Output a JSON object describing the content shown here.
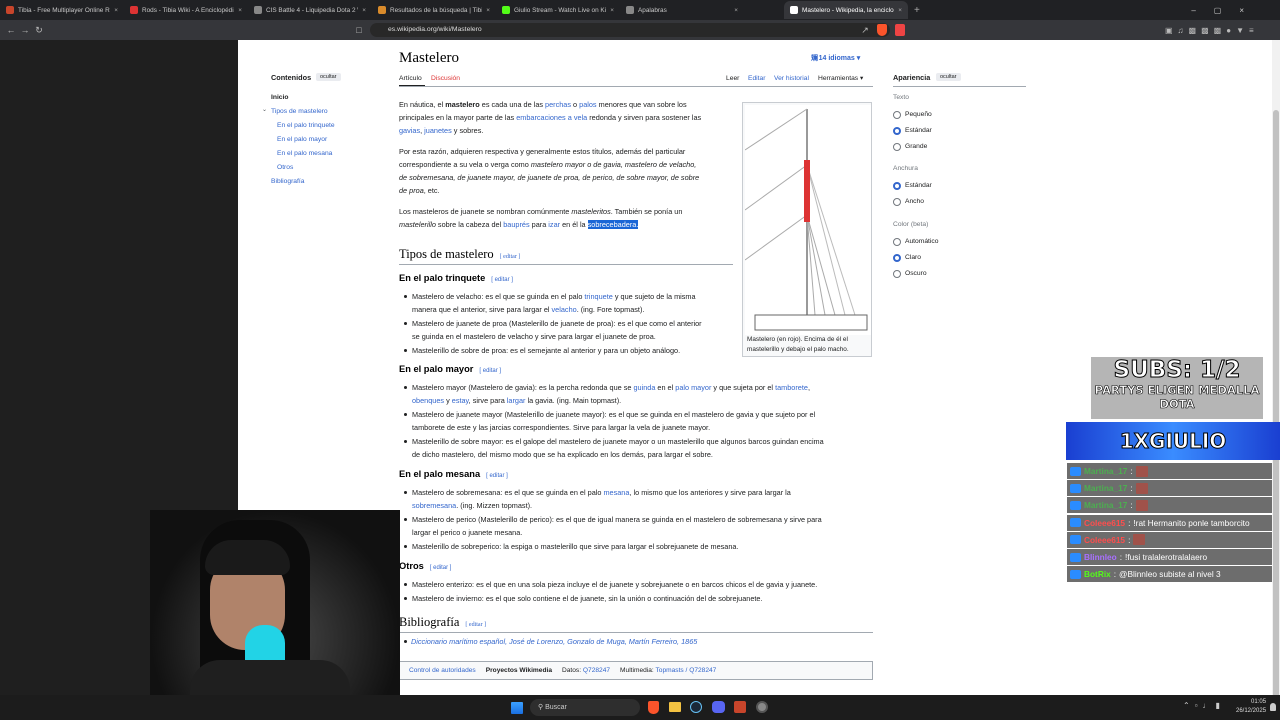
{
  "tabs": [
    {
      "label": "Tibia - Free Multiplayer Online Role",
      "color": "#c8452b"
    },
    {
      "label": "Rods - Tibia Wiki - A Enciclopédia da",
      "color": "#d33"
    },
    {
      "label": "CIS Battle 4 - Liquipedia Dota 2 Wiki",
      "color": "#888"
    },
    {
      "label": "Resultados de la búsqueda | Tibia Wiki",
      "color": "#d98b2b"
    },
    {
      "label": "Giulio Stream - Watch Live on Kick",
      "color": "#53fc18"
    },
    {
      "label": "Apalabras",
      "color": "#888"
    },
    {
      "label": "Mastelero - Wikipedia, la enciclo",
      "color": "#fff",
      "active": true
    }
  ],
  "url": "es.wikipedia.org/wiki/Mastelero",
  "toc": {
    "title": "Contenidos",
    "hide": "ocultar",
    "items": [
      {
        "label": "Inicio",
        "bold": true,
        "level": 0
      },
      {
        "label": "Tipos de mastelero",
        "level": 0,
        "toggle": true
      },
      {
        "label": "En el palo trinquete",
        "level": 1
      },
      {
        "label": "En el palo mayor",
        "level": 1
      },
      {
        "label": "En el palo mesana",
        "level": 1
      },
      {
        "label": "Otros",
        "level": 1
      },
      {
        "label": "Bibliografía",
        "level": 0
      }
    ]
  },
  "article": {
    "title": "Mastelero",
    "languages": "14 idiomas",
    "tabs": {
      "article": "Artículo",
      "talk": "Discusión"
    },
    "actions": {
      "read": "Leer",
      "edit": "Editar",
      "history": "Ver historial",
      "tools": "Herramientas"
    },
    "edit_label": "[ editar ]",
    "intro": [
      [
        "En náutica, el ",
        {
          "b": "mastelero"
        },
        " es cada una de las ",
        {
          "a": "perchas"
        },
        " o ",
        {
          "a": "palos"
        },
        " menores que van sobre los"
      ],
      [
        "principales en la mayor parte de las ",
        {
          "a": "embarcaciones a vela"
        },
        " redonda y sirven para sostener las"
      ],
      [
        {
          "a": "gavias"
        },
        ", ",
        {
          "a": "juanetes"
        },
        " y sobres."
      ],
      [],
      [
        "Por esta razón, adquieren respectiva y generalmente estos títulos, además del particular"
      ],
      [
        "correspondiente a su vela o verga como ",
        {
          "i": "mastelero mayor o de gavia, mastelero de velacho,"
        }
      ],
      [
        {
          "i": "de sobremesana, de juanete mayor, de juanete de proa, de perico, de sobre mayor, de sobre"
        }
      ],
      [
        {
          "i": "de proa"
        },
        ", etc."
      ],
      [],
      [
        "Los masteleros de juanete se nombran comúnmente ",
        {
          "i": "masteleritos"
        },
        ". También se ponía un"
      ],
      [
        {
          "i": "mastelerillo"
        },
        " sobre la cabeza del ",
        {
          "a": "bauprés"
        },
        " para ",
        {
          "a": "izar"
        },
        " en él la ",
        {
          "sel": "sobrecebadera."
        }
      ]
    ],
    "section_tipos": "Tipos de mastelero",
    "subsections": [
      {
        "title": "En el palo trinquete",
        "items": [
          [
            [
              "Mastelero de velacho: es el que se guinda en el palo ",
              {
                "a": "trinquete"
              },
              " y que sujeto de la misma"
            ],
            [
              "manera que el anterior, sirve para largar el ",
              {
                "a": "velacho"
              },
              ". (ing. Fore topmast)."
            ]
          ],
          [
            [
              "Mastelero de juanete de proa (Mastelerillo de juanete de proa): es el que como el anterior"
            ],
            [
              "se guinda en el mastelero de velacho y sirve para largar el juanete de proa."
            ]
          ],
          [
            [
              "Mastelerillo de sobre de proa: es el semejante al anterior y para un objeto análogo."
            ]
          ]
        ]
      },
      {
        "title": "En el palo mayor",
        "items": [
          [
            [
              "Mastelero mayor (Mastelero de gavia): es la percha redonda que se ",
              {
                "a": "guinda"
              },
              " en el ",
              {
                "a": "palo mayor"
              },
              " y que sujeta por el ",
              {
                "a": "tamborete"
              },
              ","
            ],
            [
              {
                "a": "obenques"
              },
              " y ",
              {
                "a": "estay"
              },
              ", sirve para ",
              {
                "a": "largar"
              },
              " la gavia. (ing. Main topmast)."
            ]
          ],
          [
            [
              "Mastelero de juanete mayor (Mastelerillo de juanete mayor): es el que se guinda en el mastelero de gavia y que sujeto por el"
            ],
            [
              "tamborete de este y las jarcias correspondientes. Sirve para largar la vela de juanete mayor."
            ]
          ],
          [
            [
              "Mastelerillo de sobre mayor: es el galope del mastelero de juanete mayor o un mastelerillo que algunos barcos guindan encima"
            ],
            [
              "de dicho mastelero, del mismo modo que se ha explicado en los demás, para largar el sobre."
            ]
          ]
        ]
      },
      {
        "title": "En el palo mesana",
        "items": [
          [
            [
              "Mastelero de sobremesana: es el que se guinda en el palo ",
              {
                "a": "mesana"
              },
              ", lo mismo que los anteriores y sirve para largar la"
            ],
            [
              {
                "a": "sobremesana"
              },
              ". (ing. Mizzen topmast)."
            ]
          ],
          [
            [
              "Mastelero de perico (Mastelerillo de perico): es el que de igual manera se guinda en el mastelero de sobremesana y sirve para"
            ],
            [
              "largar el perico o juanete mesana."
            ]
          ],
          [
            [
              "Mastelerillo de sobreperico: la espiga o mastelerillo que sirve para largar el sobrejuanete de mesana."
            ]
          ]
        ]
      },
      {
        "title": "Otros",
        "items": [
          [
            [
              "Mastelero enterizo: es el que en una sola pieza incluye el de juanete y sobrejuanete o en barcos chicos el de gavia y juanete."
            ]
          ],
          [
            [
              "Mastelero de invierno: es el que solo contiene el de juanete, sin la unión o continuación del de sobrejuanete."
            ]
          ]
        ]
      }
    ],
    "section_biblio": "Bibliografía",
    "biblio_line": "Diccionario marítimo español, José de Lorenzo, Gonzalo de Muga, Martín Ferreiro, 1865",
    "image_caption": [
      "Mastelero (en rojo). Encima de él el",
      "mastelerillo y debajo el palo macho."
    ],
    "authority": {
      "label": "Control de autoridades",
      "project": "Proyectos Wikimedia",
      "datos_label": "Datos:",
      "datos": "Q728247",
      "multimedia_label": "Multimedia:",
      "multimedia": "Topmasts / Q728247"
    }
  },
  "appearance": {
    "title": "Apariencia",
    "hide": "ocultar",
    "text": {
      "label": "Texto",
      "options": [
        "Pequeño",
        "Estándar",
        "Grande"
      ],
      "selected": 1
    },
    "width": {
      "label": "Anchura",
      "options": [
        "Estándar",
        "Ancho"
      ],
      "selected": 0
    },
    "color": {
      "label": "Color (beta)",
      "options": [
        "Automático",
        "Claro",
        "Oscuro"
      ],
      "selected": 1
    }
  },
  "overlay": {
    "subs": "SUBS: 1/2",
    "party_line1": "PARTYS ELIGEN MEDALLA",
    "party_line2": "DOTA",
    "channel": "1XGIULIO",
    "chat": [
      {
        "user": "Martina_17",
        "color": "#4caf50",
        "msg": "",
        "emote": true
      },
      {
        "user": "Martina_17",
        "color": "#4caf50",
        "msg": "",
        "emote": true
      },
      {
        "user": "Martina_17",
        "color": "#4caf50",
        "msg": "",
        "emote": true
      },
      {
        "user": "Coleee615",
        "color": "#ff4d4d",
        "msg": "!rat Hermanito ponle tamborcito"
      },
      {
        "user": "Coleee615",
        "color": "#ff4d4d",
        "msg": "",
        "emote": true
      },
      {
        "user": "Blinnleo",
        "color": "#a970ff",
        "msg": "!fusi tralalerotralalaero"
      },
      {
        "user": "BotRix",
        "color": "#53fc18",
        "msg": "@Blinnleo subiste al nivel 3"
      }
    ]
  },
  "taskbar": {
    "search": "Buscar",
    "time": "01:05",
    "date": "26/12/2025"
  }
}
